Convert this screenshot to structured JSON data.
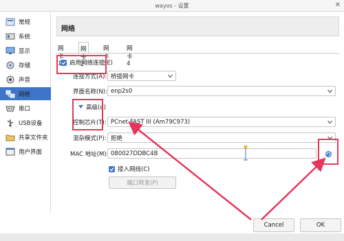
{
  "window": {
    "title": "wayos - 设置",
    "close_glyph": "✕"
  },
  "sidebar": {
    "items": [
      {
        "label": "常规",
        "icon": "general-icon",
        "active": false
      },
      {
        "label": "系统",
        "icon": "system-icon",
        "active": false
      },
      {
        "label": "显示",
        "icon": "display-icon",
        "active": false
      },
      {
        "label": "存储",
        "icon": "storage-icon",
        "active": false
      },
      {
        "label": "声音",
        "icon": "audio-icon",
        "active": false
      },
      {
        "label": "网络",
        "icon": "network-icon",
        "active": true
      },
      {
        "label": "串口",
        "icon": "serial-port-icon",
        "active": false
      },
      {
        "label": "USB设备",
        "icon": "usb-icon",
        "active": false
      },
      {
        "label": "共享文件夹",
        "icon": "shared-folder-icon",
        "active": false
      },
      {
        "label": "用户界面",
        "icon": "user-interface-icon",
        "active": false
      }
    ]
  },
  "main": {
    "header_title": "网络",
    "tabs": [
      {
        "label": "网卡 1",
        "active": false
      },
      {
        "label": "网卡 2",
        "active": true
      },
      {
        "label": "网卡 3",
        "active": false
      },
      {
        "label": "网卡 4",
        "active": false
      }
    ],
    "enable_adapter": {
      "label": "启用网络连接(E)",
      "checked": true
    },
    "attached_to": {
      "label": "连接方式(A):",
      "value": "桥接网卡"
    },
    "interface_name": {
      "label": "界面名称(N):",
      "value": "enp2s0"
    },
    "advanced": {
      "label": "高级(d)",
      "expanded": true
    },
    "adapter_type": {
      "label": "控制芯片(T):",
      "value": "PCnet-FAST III (Am79C973)"
    },
    "promiscuous": {
      "label": "混杂模式(P):",
      "value": "拒绝"
    },
    "mac": {
      "label": "MAC 地址(M):",
      "value": "080027DDBC4B"
    },
    "cable": {
      "label": "接入网线(C)",
      "checked": true
    },
    "port_forward_label": "端口转发(P)"
  },
  "footer": {
    "cancel_label": "Cancel",
    "ok_label": "OK"
  },
  "colors": {
    "accent": "#3d76c8",
    "annotation": "#e6365c"
  }
}
